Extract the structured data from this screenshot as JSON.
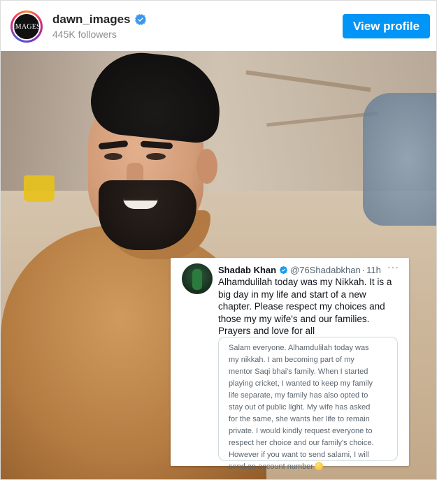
{
  "header": {
    "avatar_text": "IMAGES",
    "username": "dawn_images",
    "followers": "445K followers",
    "view_profile_label": "View profile"
  },
  "colors": {
    "accent": "#0095f6",
    "verified": "#3897f0",
    "twitter_verified": "#1d9bf0"
  },
  "icons": {
    "verified": "verified-badge-icon",
    "more": "more-options-icon",
    "emoji": "grinning-face-emoji"
  },
  "tweet": {
    "name": "Shadab Khan",
    "handle": "@76Shadabkhan",
    "separator": "·",
    "time": "11h",
    "more": "···",
    "text_lines": [
      "Alhamdulilah today was my Nikkah. It is a",
      "big day in my life  and start of a new",
      "chapter. Please respect my choices and",
      "those my my wife's and our families.",
      "Prayers and love for all"
    ],
    "quote_lines": [
      "Salam everyone. Alhamdulilah today was",
      "my nikkah. I am becoming part of my",
      "mentor Saqi bhai's family. When I started",
      "playing cricket, I wanted to keep my family",
      "life separate, my family has also opted to",
      "stay out of public light. My wife has asked",
      "for the same, she wants her life to remain",
      "private. I would kindly request everyone to",
      "respect her choice and our family's choice.",
      "However if you want to send salami, I will",
      "send an account number"
    ]
  }
}
